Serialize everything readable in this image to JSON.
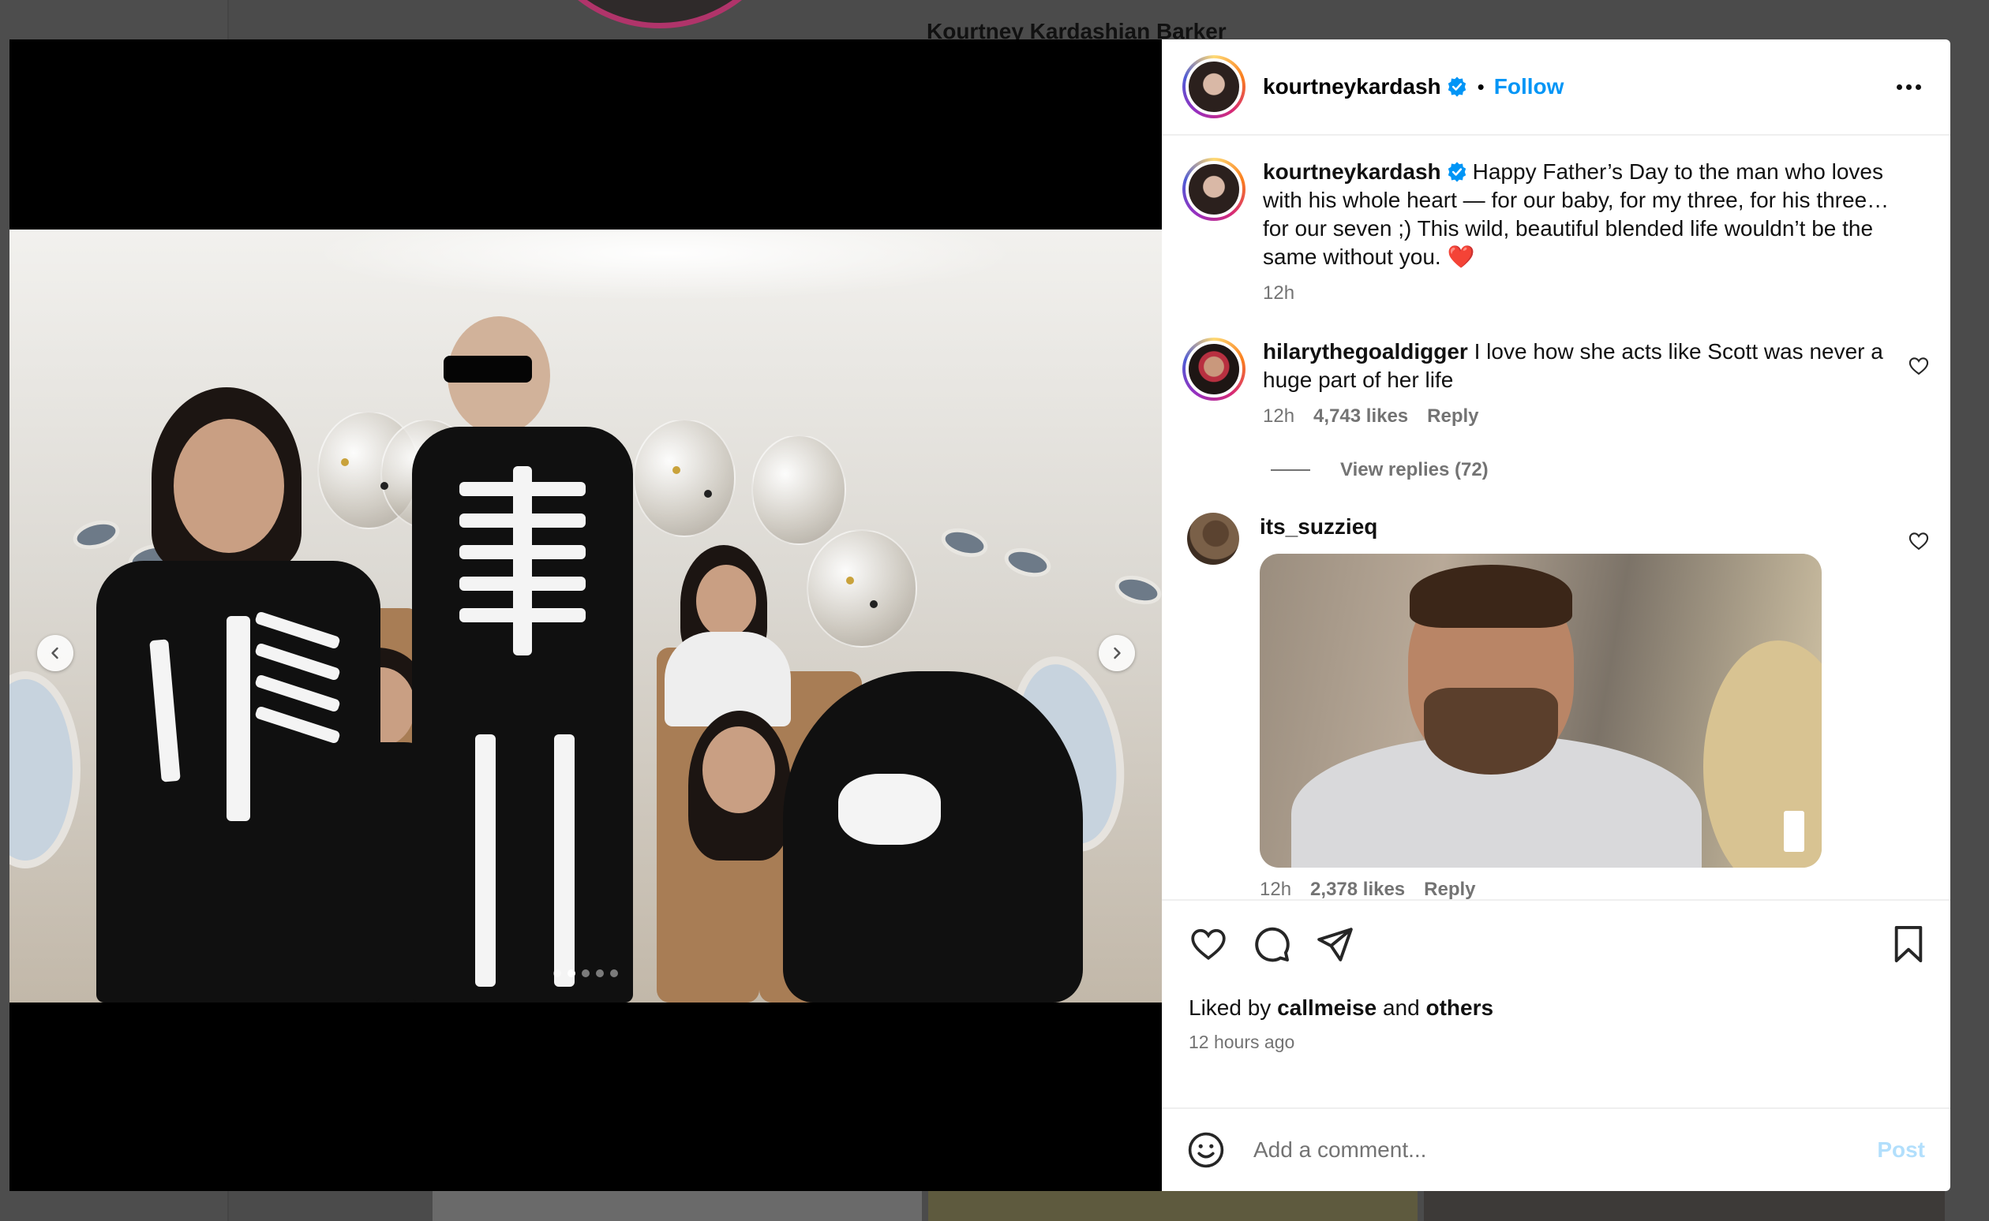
{
  "background": {
    "profile_name": "Kourtney Kardashian Barker"
  },
  "post": {
    "author": "kourtneykardash",
    "follow_label": "Follow",
    "header_separator": "•",
    "caption_author": "kourtneykardash",
    "caption": "Happy Father’s Day to the man who loves with his whole heart — for our baby, for my three, for his three… for our seven ;) This wild, beautiful blended life wouldn’t be the same without you. ❤️",
    "caption_time": "12h",
    "carousel_dots": 5,
    "carousel_active_dot": 1
  },
  "comments": [
    {
      "user": "hilarythegoaldigger",
      "text": "I love how she acts like Scott was never a huge part of her life",
      "time": "12h",
      "likes": "4,743 likes",
      "reply_label": "Reply",
      "view_replies": "View replies (72)"
    },
    {
      "user": "its_suzzieq",
      "time": "12h",
      "likes": "2,378 likes",
      "reply_label": "Reply"
    }
  ],
  "engagement": {
    "liked_by_prefix": "Liked by",
    "liked_by_user": "callmeise",
    "liked_by_and": "and",
    "liked_by_others": "others",
    "time_ago": "12 hours ago"
  },
  "composer": {
    "placeholder": "Add a comment...",
    "post_label": "Post"
  },
  "icons": {
    "verified": "verified-badge-icon",
    "more": "more-options-icon",
    "like": "heart-icon",
    "comment": "comment-bubble-icon",
    "share": "paper-plane-icon",
    "save": "bookmark-icon",
    "emoji": "emoji-smiley-icon",
    "prev": "chevron-left-icon",
    "next": "chevron-right-icon"
  },
  "colors": {
    "accent": "#0095f6",
    "post_disabled": "#b2dffc",
    "verified": "#0095f6",
    "muted_text": "#737373"
  }
}
